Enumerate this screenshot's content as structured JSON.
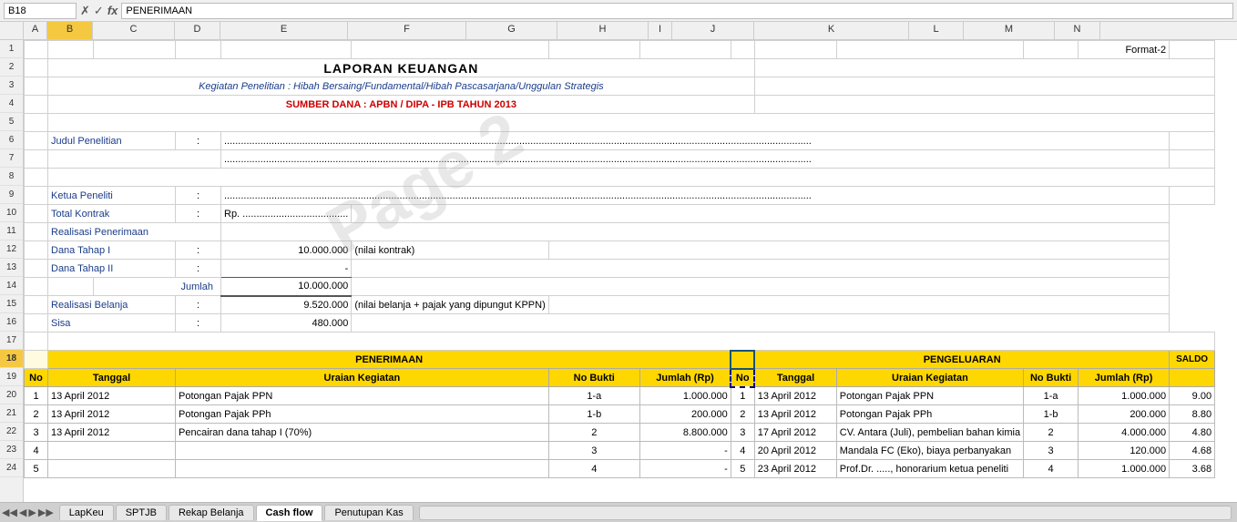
{
  "formulaBar": {
    "cellName": "B18",
    "icons": [
      "✗",
      "✓",
      "fx"
    ],
    "value": "PENERIMAAN"
  },
  "columns": [
    {
      "label": "",
      "width": 26
    },
    {
      "label": "A",
      "width": 26
    },
    {
      "label": "B",
      "width": 50
    },
    {
      "label": "C",
      "width": 90
    },
    {
      "label": "D",
      "width": 50
    },
    {
      "label": "E",
      "width": 140
    },
    {
      "label": "F",
      "width": 130
    },
    {
      "label": "G",
      "width": 100
    },
    {
      "label": "H",
      "width": 100
    },
    {
      "label": "I",
      "width": 26
    },
    {
      "label": "J",
      "width": 90
    },
    {
      "label": "K",
      "width": 140
    },
    {
      "label": "L",
      "width": 60
    },
    {
      "label": "M",
      "width": 100
    },
    {
      "label": "N",
      "width": 40
    }
  ],
  "rows": [
    1,
    2,
    3,
    4,
    5,
    6,
    7,
    8,
    9,
    10,
    11,
    12,
    13,
    14,
    15,
    16,
    17,
    18,
    19,
    20,
    21,
    22,
    23,
    24
  ],
  "activeRow": 18,
  "tabs": [
    "LapKeu",
    "SPTJB",
    "Rekap Belanja",
    "Cash flow",
    "Penutupan Kas"
  ],
  "activeTab": "Cash flow",
  "mainTitle": "LAPORAN KEUANGAN",
  "subtitle": "Kegiatan Penelitian : Hibah Bersaing/Fundamental/Hibah Pascasarjana/Unggulan Strategis",
  "sourceTitle": "SUMBER DANA : APBN / DIPA - IPB TAHUN 2013",
  "formatLabel": "Format-2",
  "labels": {
    "judulPenelitian": "Judul Penelitian",
    "ketuaPeneliti": "Ketua Peneliti",
    "totalKontrak": "Total Kontrak",
    "realisasiPenerimaan": "Realisasi  Penerimaan",
    "danaTahapI": "Dana Tahap I",
    "danaTahapII": "Dana Tahap II",
    "jumlah": "Jumlah",
    "realisasiBelanja": "Realisasi Belanja",
    "sisa": "Sisa"
  },
  "values": {
    "rp": "Rp. ......................................",
    "danaTahapIValue": "10.000.000",
    "danaTahapIDash": "-",
    "jumlahValue": "10.000.000",
    "realisasiBelanjaValue": "9.520.000",
    "realisasiBelanjaNote": "(nilai belanja + pajak yang dipungut KPPN)",
    "sisaValue": "480.000",
    "nilaiKontrak": "(nilai kontrak)"
  },
  "tableHeaders": {
    "penerimaan": "PENERIMAAN",
    "pengeluaran": "PENGELUARAN",
    "no": "No",
    "tanggal": "Tanggal",
    "uraianKegiatan": "Uraian Kegiatan",
    "noBukti": "No Bukti",
    "jumlahRp": "Jumlah (Rp)",
    "saldo": "SALDO"
  },
  "penerimaanRows": [
    {
      "no": "1",
      "tanggal": "13 April 2012",
      "uraian": "Potongan Pajak PPN",
      "noBukti": "1-a",
      "jumlah": "1.000.000"
    },
    {
      "no": "2",
      "tanggal": "13 April 2012",
      "uraian": "Potongan Pajak PPh",
      "noBukti": "1-b",
      "jumlah": "200.000"
    },
    {
      "no": "3",
      "tanggal": "13 April 2012",
      "uraian": "Pencairan dana tahap I (70%)",
      "noBukti": "2",
      "jumlah": "8.800.000"
    },
    {
      "no": "4",
      "tanggal": "",
      "uraian": "",
      "noBukti": "3",
      "jumlah": "-"
    },
    {
      "no": "5",
      "tanggal": "",
      "uraian": "",
      "noBukti": "4",
      "jumlah": "-"
    }
  ],
  "pengeluaranRows": [
    {
      "no": "1",
      "tanggal": "13 April 2012",
      "uraian": "Potongan Pajak PPN",
      "noBukti": "1-a",
      "jumlah": "1.000.000",
      "saldo": "9.00"
    },
    {
      "no": "2",
      "tanggal": "13 April 2012",
      "uraian": "Potongan Pajak PPh",
      "noBukti": "1-b",
      "jumlah": "200.000",
      "saldo": "8.80"
    },
    {
      "no": "3",
      "tanggal": "17 April 2012",
      "uraian": "CV. Antara (Juli), pembelian bahan kimia",
      "noBukti": "2",
      "jumlah": "4.000.000",
      "saldo": "4.80"
    },
    {
      "no": "4",
      "tanggal": "20 April 2012",
      "uraian": "Mandala FC (Eko), biaya perbanyakan",
      "noBukti": "3",
      "jumlah": "120.000",
      "saldo": "4.68"
    },
    {
      "no": "5",
      "tanggal": "23 April 2012",
      "uraian": "Prof.Dr. ....., honorarium ketua peneliti",
      "noBukti": "4",
      "jumlah": "1.000.000",
      "saldo": "3.68"
    }
  ]
}
